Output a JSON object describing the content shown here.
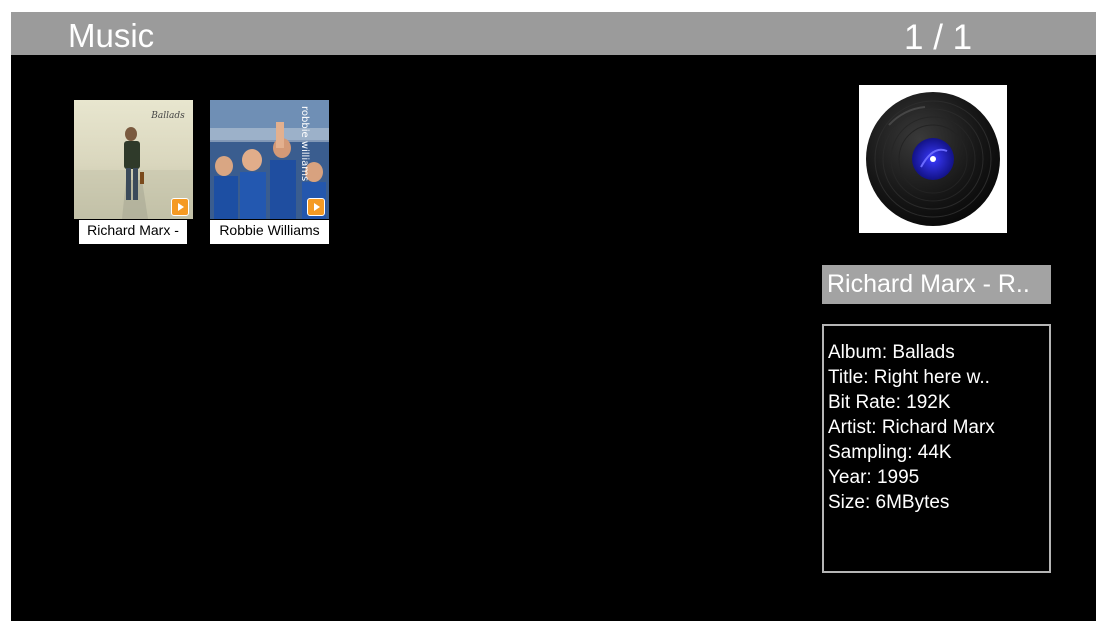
{
  "header": {
    "title": "Music",
    "page_indicator": "1 / 1"
  },
  "items": [
    {
      "label": "Richard Marx -",
      "cover_text": "Ballads"
    },
    {
      "label": "Robbie Williams",
      "cover_text": "robbie williams"
    }
  ],
  "preview": {
    "title": "Richard Marx - R..",
    "info": [
      "Album: Ballads",
      "Title: Right here w..",
      "Bit Rate: 192K",
      "Artist: Richard Marx",
      "Sampling: 44K",
      "Year: 1995",
      "Size: 6MBytes"
    ]
  },
  "colors": {
    "header_bg": "#9b9b9b",
    "screen_bg": "#000000",
    "play_badge": "#f59a23",
    "title_bg": "#a3a3a3"
  }
}
